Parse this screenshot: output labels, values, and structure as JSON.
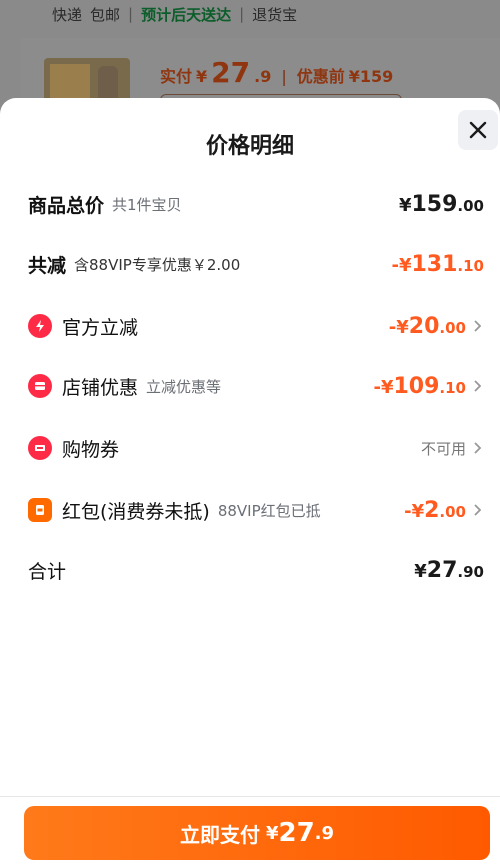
{
  "background": {
    "delivery": [
      "快递",
      "包邮"
    ],
    "delivery_green": "预计后天送达",
    "return_text": "退货宝",
    "paid_label": "实付",
    "paid_currency": "¥",
    "paid_int": "27",
    "paid_dec": ".9",
    "before_label": "优惠前",
    "before_value": "¥159"
  },
  "sheet": {
    "title": "价格明细",
    "rows": [
      {
        "label": "商品总价",
        "sub": "共1件宝贝",
        "amount_prefix": "",
        "currency": "¥",
        "int": "159",
        "dec": ".00",
        "color": "#1a1a1a",
        "icon": null
      },
      {
        "label": "共减",
        "sub": "含88VIP专享优惠￥2.00",
        "amount_prefix": "-",
        "currency": "¥",
        "int": "131",
        "dec": ".10",
        "color": "#ff5a1f",
        "icon": null
      },
      {
        "label": "官方立减",
        "sub": "",
        "amount_prefix": "-",
        "currency": "¥",
        "int": "20",
        "dec": ".00",
        "color": "#ff5a1f",
        "icon": "lightning-icon"
      },
      {
        "label": "店铺优惠",
        "sub": "立减优惠等",
        "amount_prefix": "-",
        "currency": "¥",
        "int": "109",
        "dec": ".10",
        "color": "#ff5a1f",
        "icon": "shop-icon"
      },
      {
        "label": "购物券",
        "sub": "",
        "right_text": "不可用",
        "icon": "ticket-icon"
      },
      {
        "label": "红包(消费券未抵)",
        "sub": "88VIP红包已抵",
        "amount_prefix": "-",
        "currency": "¥",
        "int": "2",
        "dec": ".00",
        "color": "#ff5a1f",
        "icon": "red-packet-icon"
      },
      {
        "label": "合计",
        "sub": "",
        "amount_prefix": "",
        "currency": "¥",
        "int": "27",
        "dec": ".90",
        "color": "#1a1a1a",
        "icon": null
      }
    ]
  },
  "pay_button": {
    "label": "立即支付",
    "currency": "¥",
    "int": "27",
    "dec": ".9"
  },
  "colors": {
    "accent": "#ff5a1f",
    "icon_red": "#ff2a45",
    "button": "#ff6a00"
  }
}
